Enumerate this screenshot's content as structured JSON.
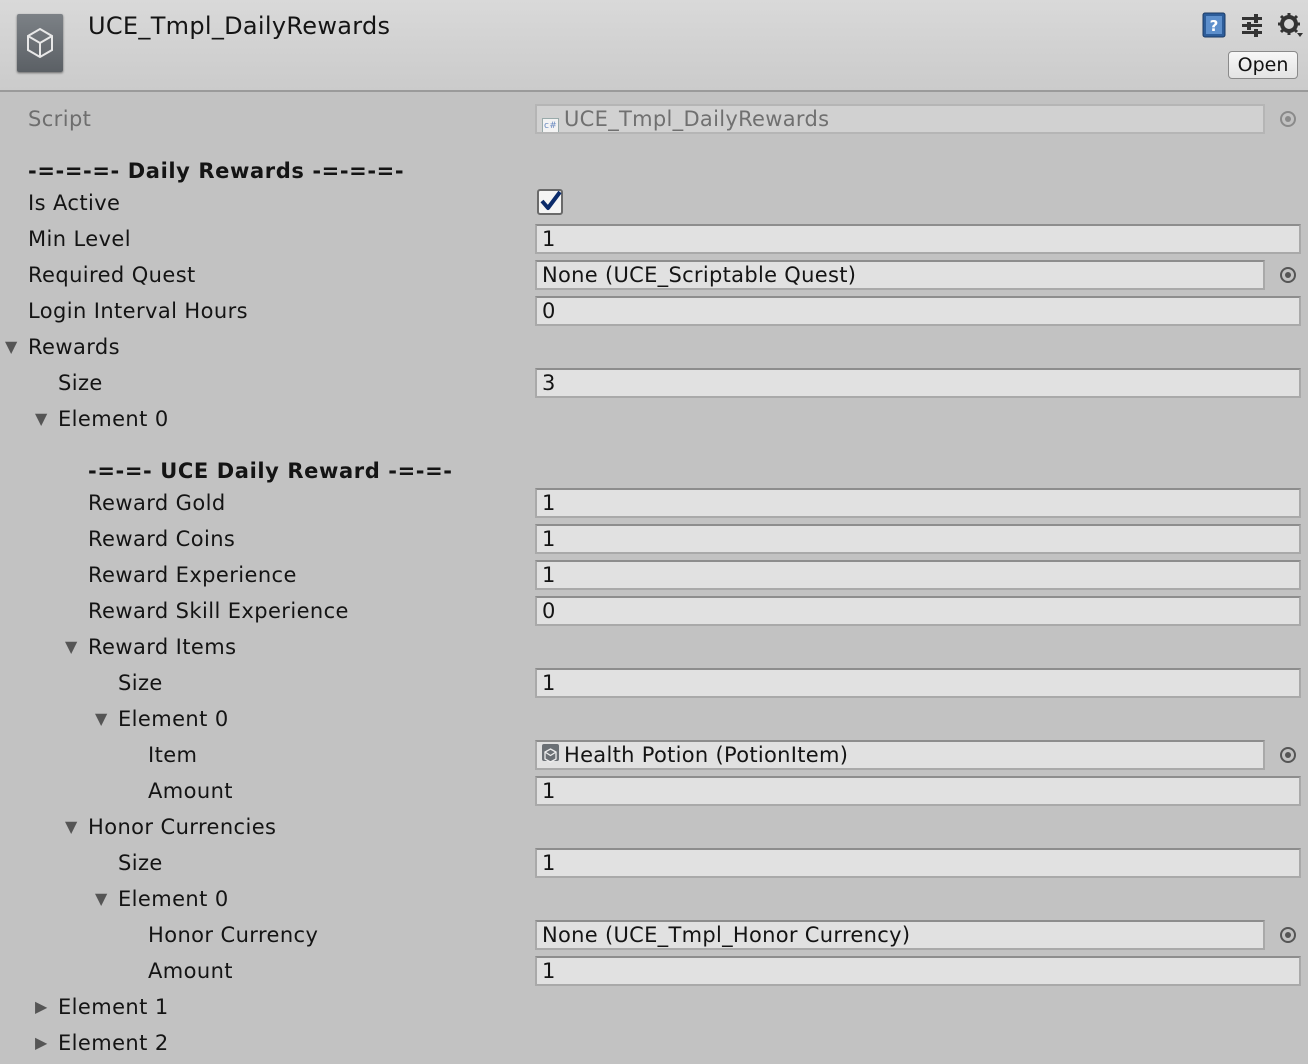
{
  "header": {
    "title": "UCE_Tmpl_DailyRewards",
    "open_label": "Open"
  },
  "rows": {
    "script": {
      "label": "Script",
      "value": "UCE_Tmpl_DailyRewards"
    },
    "section_daily": {
      "label": "-=-=-=- Daily Rewards -=-=-=-"
    },
    "is_active": {
      "label": "Is Active",
      "checked": true
    },
    "min_level": {
      "label": "Min Level",
      "value": "1"
    },
    "required_quest": {
      "label": "Required Quest",
      "value": "None (UCE_Scriptable Quest)"
    },
    "login_interval": {
      "label": "Login Interval Hours",
      "value": "0"
    },
    "rewards": {
      "label": "Rewards"
    },
    "rewards_size": {
      "label": "Size",
      "value": "3"
    },
    "element0": {
      "label": "Element 0"
    },
    "section_uce": {
      "label": "-=-=- UCE Daily Reward -=-=-"
    },
    "reward_gold": {
      "label": "Reward Gold",
      "value": "1"
    },
    "reward_coins": {
      "label": "Reward Coins",
      "value": "1"
    },
    "reward_experience": {
      "label": "Reward Experience",
      "value": "1"
    },
    "reward_skill_experience": {
      "label": "Reward Skill Experience",
      "value": "0"
    },
    "reward_items": {
      "label": "Reward Items"
    },
    "reward_items_size": {
      "label": "Size",
      "value": "1"
    },
    "reward_items_element0": {
      "label": "Element 0"
    },
    "item": {
      "label": "Item",
      "value": "Health Potion (PotionItem)"
    },
    "item_amount": {
      "label": "Amount",
      "value": "1"
    },
    "honor_currencies": {
      "label": "Honor Currencies"
    },
    "honor_size": {
      "label": "Size",
      "value": "1"
    },
    "honor_element0": {
      "label": "Element 0"
    },
    "honor_currency": {
      "label": "Honor Currency",
      "value": "None (UCE_Tmpl_Honor Currency)"
    },
    "honor_amount": {
      "label": "Amount",
      "value": "1"
    },
    "element1": {
      "label": "Element 1"
    },
    "element2": {
      "label": "Element 2"
    }
  },
  "icons": {
    "header_object": "unity-logo-icon",
    "help": "help-book-icon",
    "presets": "presets-sliders-icon",
    "settings": "gear-icon",
    "script_field": "csharp-script-icon",
    "item_field": "unity-asset-icon",
    "picker": "object-picker-icon",
    "expanded": "triangle-down-icon",
    "collapsed": "triangle-right-icon"
  },
  "colors": {
    "background": "#c2c2c2",
    "header": "#d4d4d4",
    "field": "#e1e1e1",
    "checkmark": "#0a2a6a"
  }
}
